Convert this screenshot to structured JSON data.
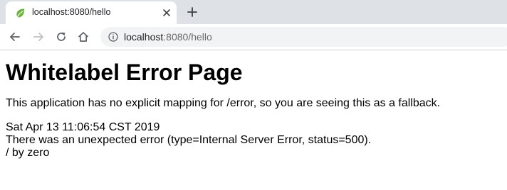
{
  "browser": {
    "tab": {
      "title": "localhost:8080/hello",
      "favicon": "spring-leaf-icon"
    },
    "address_bar": {
      "host": "localhost",
      "rest": ":8080/hello"
    },
    "colors": {
      "tabstrip": "#dee1e6",
      "omnibox": "#f1f3f4",
      "favicon_green": "#6db33f"
    }
  },
  "page": {
    "heading": "Whitelabel Error Page",
    "message": "This application has no explicit mapping for /error, so you are seeing this as a fallback.",
    "timestamp": "Sat Apr 13 11:06:54 CST 2019",
    "error_line": "There was an unexpected error (type=Internal Server Error, status=500).",
    "exception": "/ by zero"
  }
}
